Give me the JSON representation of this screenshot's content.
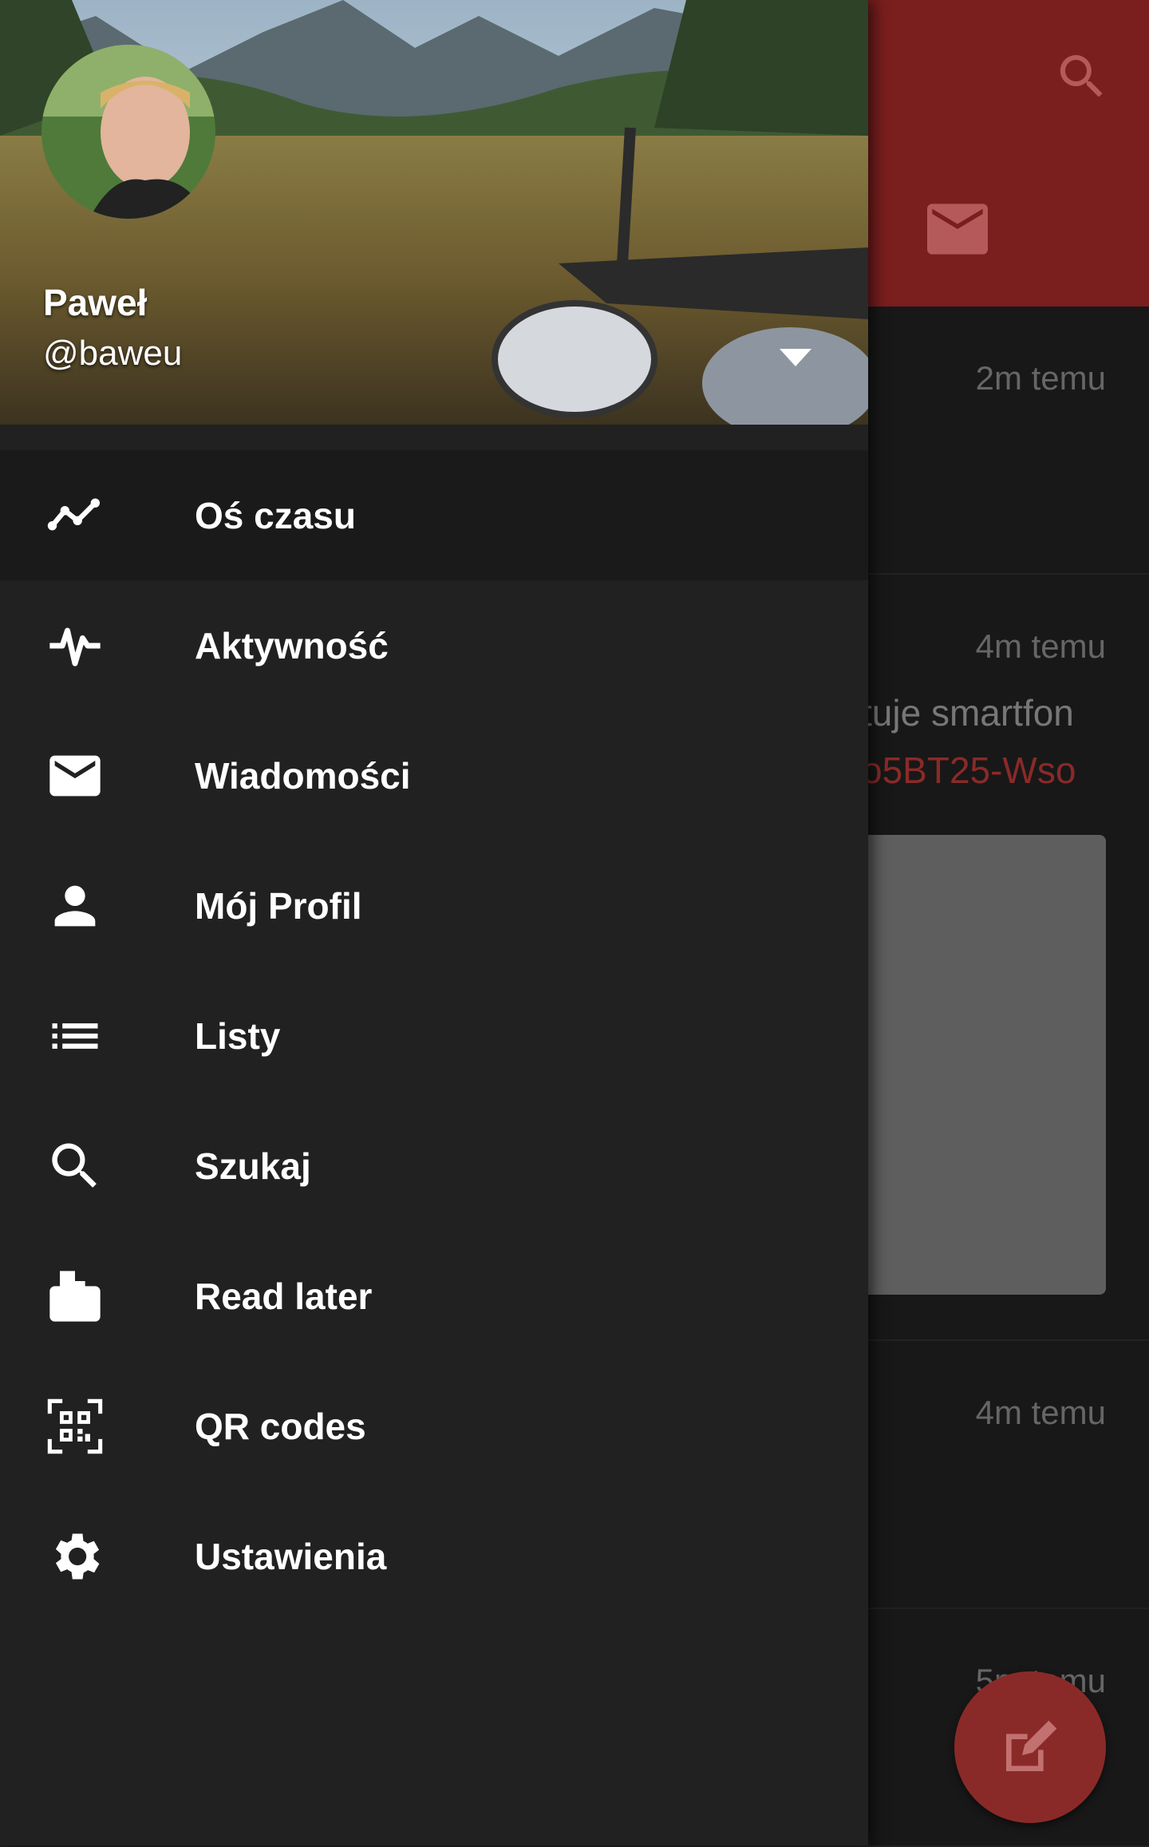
{
  "background": {
    "feed": [
      {
        "time": "2m temu"
      },
      {
        "time": "4m temu",
        "text": "tuje smartfon",
        "link": "o5BT25-Wso"
      },
      {
        "time": "4m temu"
      },
      {
        "time": "5m temu"
      }
    ]
  },
  "user": {
    "name": "Paweł",
    "handle": "@baweu"
  },
  "menu": [
    {
      "label": "Oś czasu",
      "icon": "timeline-icon"
    },
    {
      "label": "Aktywność",
      "icon": "activity-icon"
    },
    {
      "label": "Wiadomości",
      "icon": "mail-icon"
    },
    {
      "label": "Mój Profil",
      "icon": "person-icon"
    },
    {
      "label": "Listy",
      "icon": "list-icon"
    },
    {
      "label": "Szukaj",
      "icon": "search-icon"
    },
    {
      "label": "Read later",
      "icon": "read-later-icon"
    },
    {
      "label": "QR codes",
      "icon": "qr-code-icon"
    },
    {
      "label": "Ustawienia",
      "icon": "settings-icon"
    }
  ],
  "colors": {
    "accent": "#8a2a28",
    "drawer_bg": "#212121",
    "active_item_bg": "#1a1a1a"
  }
}
